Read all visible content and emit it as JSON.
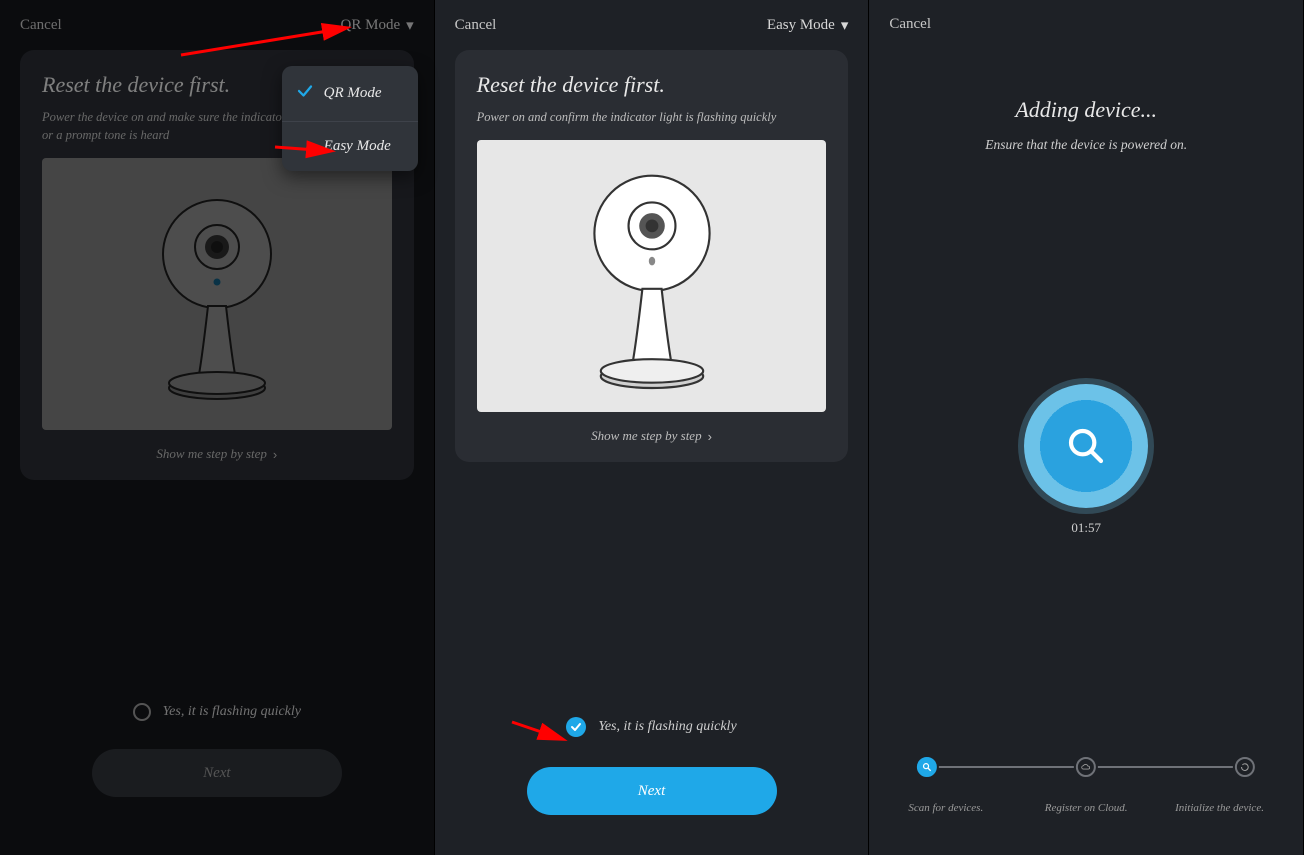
{
  "screen1": {
    "cancel": "Cancel",
    "mode_label": "QR Mode",
    "title": "Reset the device first.",
    "subtitle": "Power the device on and make sure the indicator is flashing quickly or a prompt tone is heard",
    "step_link": "Show me step by step",
    "confirm_label": "Yes, it is flashing quickly",
    "next": "Next",
    "dropdown": {
      "item1": "QR Mode",
      "item2": "Easy Mode"
    }
  },
  "screen2": {
    "cancel": "Cancel",
    "mode_label": "Easy Mode",
    "title": "Reset the device first.",
    "subtitle": "Power on and confirm the indicator light is flashing quickly",
    "step_link": "Show me step by step",
    "confirm_label": "Yes, it is flashing quickly",
    "next": "Next"
  },
  "screen3": {
    "cancel": "Cancel",
    "title": "Adding device...",
    "subtitle": "Ensure that the device is powered on.",
    "timer": "01:57",
    "steps": {
      "s1": "Scan for devices.",
      "s2": "Register on Cloud.",
      "s3": "Initialize the device."
    }
  }
}
